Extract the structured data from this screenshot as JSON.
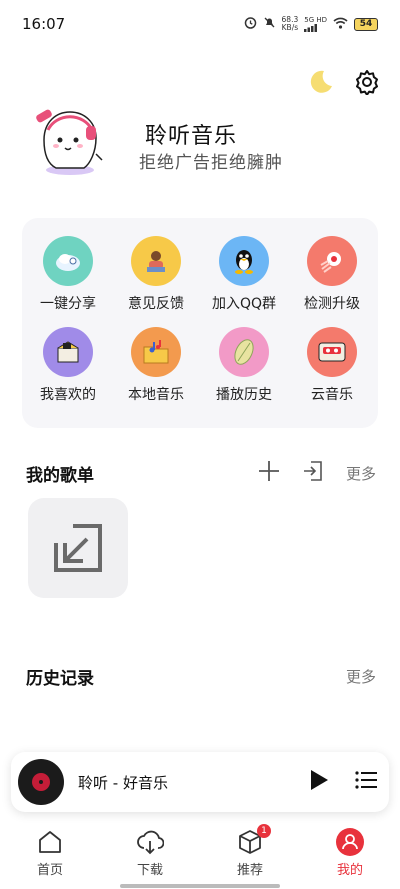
{
  "status_bar": {
    "time": "16:07",
    "net_speed_value": "68.3",
    "net_speed_unit": "KB/s",
    "signal_label": "5G HD",
    "battery": "54"
  },
  "profile": {
    "app_name": "聆听音乐",
    "slogan": "拒绝广告拒绝臃肿"
  },
  "grid": {
    "items": [
      {
        "label": "一键分享",
        "icon": "share-icon",
        "color": "#6fd3c1"
      },
      {
        "label": "意见反馈",
        "icon": "feedback-icon",
        "color": "#f7c948"
      },
      {
        "label": "加入QQ群",
        "icon": "qq-icon",
        "color": "#6cb6f5"
      },
      {
        "label": "检测升级",
        "icon": "upgrade-icon",
        "color": "#f47a6c"
      },
      {
        "label": "我喜欢的",
        "icon": "favorites-icon",
        "color": "#a08be8"
      },
      {
        "label": "本地音乐",
        "icon": "local-music-icon",
        "color": "#f39a4e"
      },
      {
        "label": "播放历史",
        "icon": "history-icon",
        "color": "#f29ac7"
      },
      {
        "label": "云音乐",
        "icon": "cloud-music-icon",
        "color": "#f47a6c"
      }
    ]
  },
  "playlists": {
    "title": "我的歌单",
    "more": "更多"
  },
  "history": {
    "title": "历史记录",
    "more": "更多"
  },
  "player": {
    "track": "聆听 - 好音乐"
  },
  "tabs": [
    {
      "label": "首页",
      "icon": "home-icon"
    },
    {
      "label": "下载",
      "icon": "download-icon"
    },
    {
      "label": "推荐",
      "icon": "recommend-icon",
      "badge": "1"
    },
    {
      "label": "我的",
      "icon": "profile-icon",
      "active": true
    }
  ],
  "colors": {
    "accent": "#e8323c",
    "moon": "#f4d35e",
    "card_bg": "#f6f6f9"
  }
}
